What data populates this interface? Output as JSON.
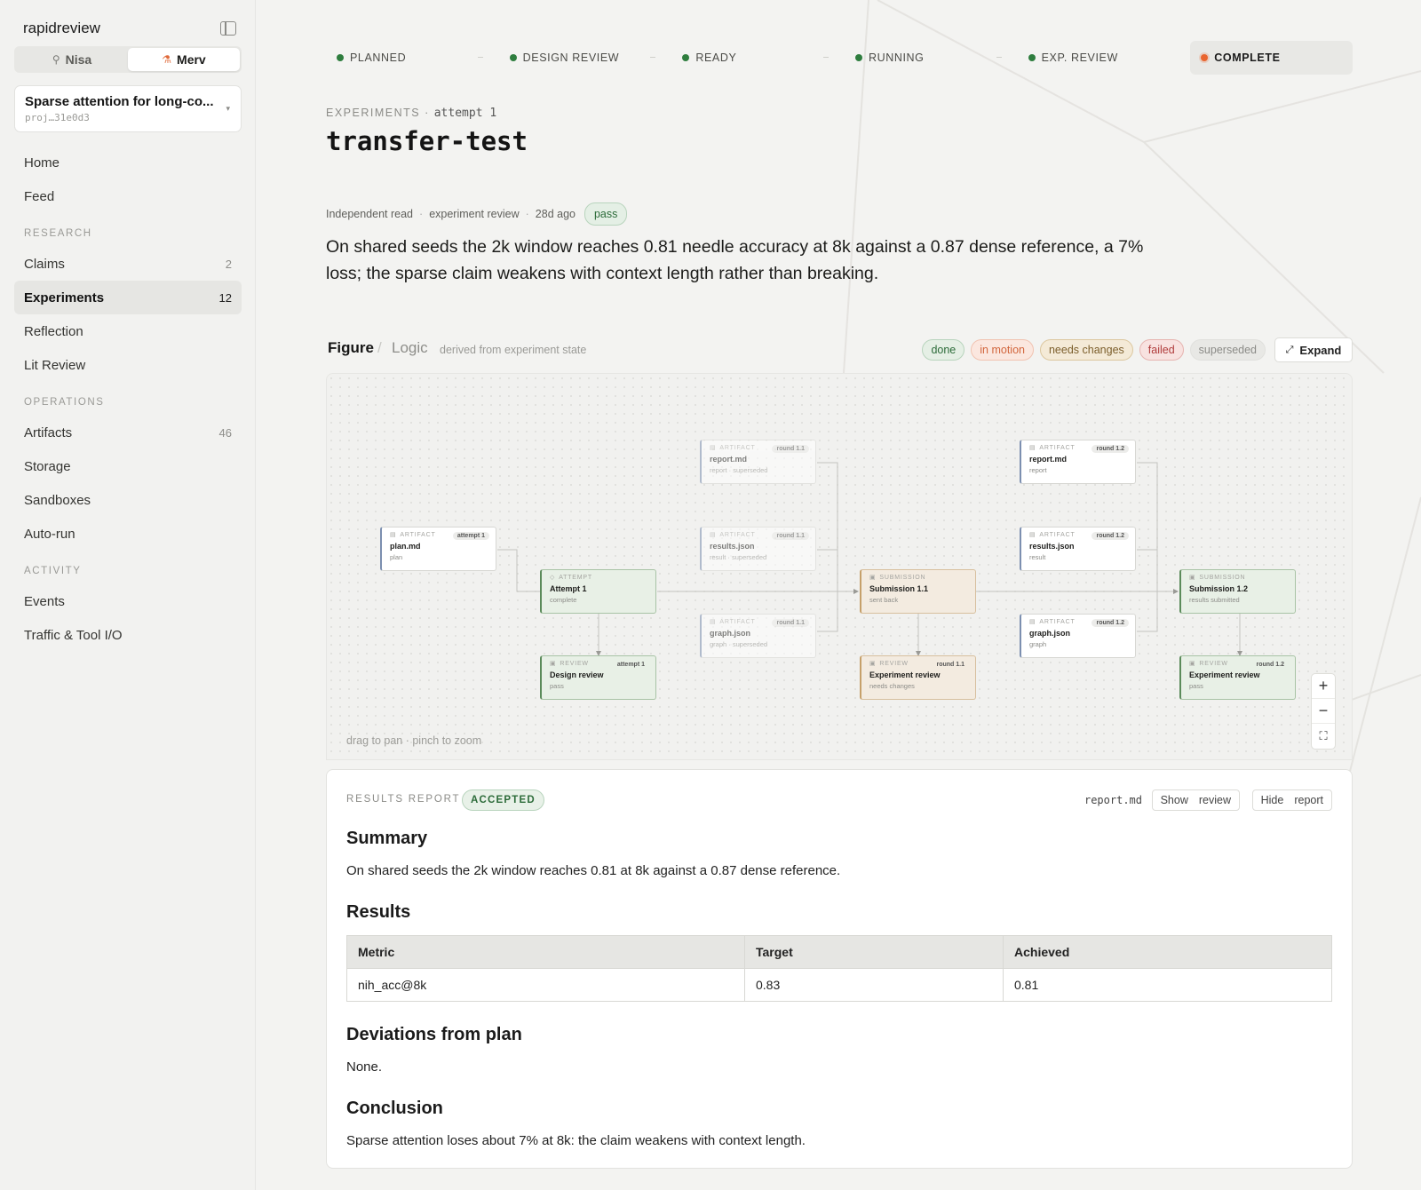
{
  "sidebar": {
    "brand": "rapidreview",
    "users": [
      {
        "name": "Nisa",
        "icon": "person-icon"
      },
      {
        "name": "Merv",
        "icon": "flask-icon"
      }
    ],
    "project": {
      "name": "Sparse attention for long-co...",
      "id": "proj…31e0d3"
    },
    "top_items": [
      {
        "label": "Home"
      },
      {
        "label": "Feed"
      }
    ],
    "sections": [
      {
        "title": "RESEARCH",
        "items": [
          {
            "label": "Claims",
            "count": "2"
          },
          {
            "label": "Experiments",
            "count": "12"
          },
          {
            "label": "Reflection",
            "count": ""
          },
          {
            "label": "Lit Review",
            "count": ""
          }
        ]
      },
      {
        "title": "OPERATIONS",
        "items": [
          {
            "label": "Artifacts",
            "count": "46"
          },
          {
            "label": "Storage",
            "count": ""
          },
          {
            "label": "Sandboxes",
            "count": ""
          },
          {
            "label": "Auto-run",
            "count": ""
          }
        ]
      },
      {
        "title": "ACTIVITY",
        "items": [
          {
            "label": "Events",
            "count": ""
          },
          {
            "label": "Traffic & Tool I/O",
            "count": ""
          }
        ]
      }
    ]
  },
  "stages": [
    "PLANNED",
    "DESIGN REVIEW",
    "READY",
    "RUNNING",
    "EXP. REVIEW",
    "COMPLETE"
  ],
  "header": {
    "eyebrow": "EXPERIMENTS",
    "attempt": "attempt 1",
    "title": "transfer-test"
  },
  "review_meta": {
    "kind": "Independent read",
    "type": "experiment review",
    "age": "28d ago",
    "verdict": "pass"
  },
  "review_summary": "On shared seeds the 2k window reaches 0.81 needle accuracy at 8k against a 0.87 dense reference, a 7% loss; the sparse claim weakens with context length rather than breaking.",
  "figure": {
    "tab_figure": "Figure",
    "tab_logic": "Logic",
    "subtitle": "derived from experiment state",
    "legend": [
      "done",
      "in motion",
      "needs changes",
      "failed",
      "superseded"
    ],
    "expand_label": "Expand",
    "drag_hint": "drag to pan · pinch to zoom",
    "nodes": {
      "plan": {
        "kind": "ARTIFACT",
        "title": "plan.md",
        "sub": "plan",
        "round": "attempt 1"
      },
      "attempt": {
        "kind": "ATTEMPT",
        "title": "Attempt 1",
        "sub": "complete"
      },
      "design_review": {
        "kind": "REVIEW",
        "title": "Design review",
        "sub": "pass",
        "round": "attempt 1"
      },
      "report_11": {
        "kind": "ARTIFACT",
        "title": "report.md",
        "sub": "report · superseded",
        "round": "round 1.1"
      },
      "results_11": {
        "kind": "ARTIFACT",
        "title": "results.json",
        "sub": "result · superseded",
        "round": "round 1.1"
      },
      "graph_11": {
        "kind": "ARTIFACT",
        "title": "graph.json",
        "sub": "graph · superseded",
        "round": "round 1.1"
      },
      "submission_11": {
        "kind": "SUBMISSION",
        "title": "Submission 1.1",
        "sub": "sent back"
      },
      "exp_review_11": {
        "kind": "REVIEW",
        "title": "Experiment review",
        "sub": "needs changes",
        "round": "round 1.1"
      },
      "report_12": {
        "kind": "ARTIFACT",
        "title": "report.md",
        "sub": "report",
        "round": "round 1.2"
      },
      "results_12": {
        "kind": "ARTIFACT",
        "title": "results.json",
        "sub": "result",
        "round": "round 1.2"
      },
      "graph_12": {
        "kind": "ARTIFACT",
        "title": "graph.json",
        "sub": "graph",
        "round": "round 1.2"
      },
      "submission_12": {
        "kind": "SUBMISSION",
        "title": "Submission 1.2",
        "sub": "results submitted"
      },
      "exp_review_12": {
        "kind": "REVIEW",
        "title": "Experiment review",
        "sub": "pass",
        "round": "round 1.2"
      }
    }
  },
  "report": {
    "label": "RESULTS REPORT",
    "status": "ACCEPTED",
    "file": "report.md",
    "show_btn": [
      "Show",
      "review"
    ],
    "hide_btn": [
      "Hide",
      "report"
    ],
    "summary_heading": "Summary",
    "summary": "On shared seeds the 2k window reaches 0.81 at 8k against a 0.87 dense reference.",
    "results_heading": "Results",
    "table": {
      "headers": [
        "Metric",
        "Target",
        "Achieved"
      ],
      "rows": [
        [
          "nih_acc@8k",
          "0.83",
          "0.81"
        ]
      ]
    },
    "deviations_heading": "Deviations from plan",
    "deviations": "None.",
    "conclusion_heading": "Conclusion",
    "conclusion": "Sparse attention loses about 7% at 8k: the claim weakens with context length."
  },
  "colors": {
    "done": "#2e7d3e",
    "active": "#e9652f",
    "accent_bg": "#f3f3f1"
  }
}
